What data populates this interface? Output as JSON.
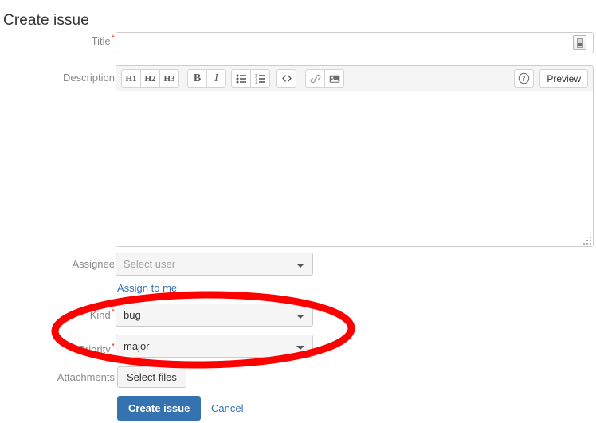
{
  "page": {
    "title": "Create issue"
  },
  "form": {
    "title_field": {
      "label": "Title",
      "required_marker": "*",
      "value": "",
      "placeholder": "",
      "badge_icon": "form-autofill-icon"
    },
    "description_field": {
      "label": "Description",
      "required_marker": "",
      "value": "",
      "placeholder": "",
      "toolbar": {
        "heading_group": [
          {
            "name": "heading-1-button",
            "label": "H1"
          },
          {
            "name": "heading-2-button",
            "label": "H2"
          },
          {
            "name": "heading-3-button",
            "label": "H3"
          }
        ],
        "style_group": [
          {
            "name": "bold-button",
            "label": "B"
          },
          {
            "name": "italic-button",
            "label": "I"
          }
        ],
        "list_group": [
          {
            "name": "bulleted-list-button",
            "label": ""
          },
          {
            "name": "numbered-list-button",
            "label": ""
          }
        ],
        "code_button": {
          "name": "code-block-button",
          "label": ""
        },
        "link_button": {
          "name": "link-button",
          "label": ""
        },
        "image_button": {
          "name": "image-button",
          "label": ""
        },
        "help_button": {
          "name": "help-icon",
          "label": "?"
        },
        "preview_button": {
          "name": "preview-button",
          "label": "Preview"
        }
      }
    },
    "assignee_field": {
      "label": "Assignee",
      "required_marker": "",
      "value": "Select user",
      "is_placeholder": true,
      "assign_to_me_link": "Assign to me"
    },
    "kind_field": {
      "label": "Kind",
      "required_marker": "*",
      "value": "bug"
    },
    "priority_field": {
      "label": "Priority",
      "required_marker": "*",
      "value": "major"
    },
    "attachments_field": {
      "label": "Attachments",
      "required_marker": "",
      "select_files_label": "Select files"
    },
    "actions": {
      "submit_label": "Create issue",
      "cancel_label": "Cancel"
    }
  },
  "annotation": {
    "shape": "ellipse",
    "color": "#fe0000",
    "stroke_width": 8,
    "highlights": [
      "kind_field",
      "priority_field"
    ]
  },
  "colors": {
    "primary_button": "#3572b0",
    "link": "#3572b0",
    "required_asterisk": "#d04437",
    "label_text": "#8a8a8a",
    "field_border": "#cccccc",
    "field_background": "#f5f5f5",
    "annotation": "#fe0000"
  }
}
